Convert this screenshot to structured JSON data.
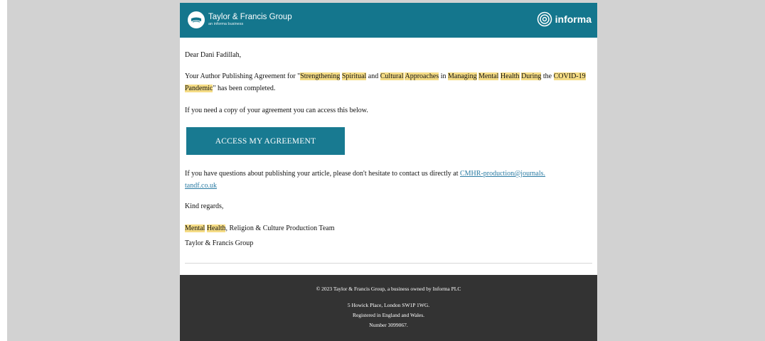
{
  "header": {
    "brand_name": "Taylor & Francis Group",
    "brand_subtitle": "an informa business",
    "partner_name": "informa",
    "background_color": "#14768d"
  },
  "email": {
    "greeting": "Dear Dani Fadillah,",
    "agreement_intro": "Your Author Publishing Agreement for \"",
    "title_parts": [
      {
        "text": "Strengthening",
        "hl": true
      },
      {
        "text": " ",
        "hl": false
      },
      {
        "text": "Spiritual",
        "hl": true
      },
      {
        "text": " and ",
        "hl": false
      },
      {
        "text": "Cultural",
        "hl": true
      },
      {
        "text": " ",
        "hl": false
      },
      {
        "text": "Approaches",
        "hl": true
      },
      {
        "text": " in ",
        "hl": false
      },
      {
        "text": "Managing",
        "hl": true
      },
      {
        "text": " ",
        "hl": false
      },
      {
        "text": "Mental",
        "hl": true
      },
      {
        "text": " ",
        "hl": false
      },
      {
        "text": "Health",
        "hl": true
      },
      {
        "text": " ",
        "hl": false
      },
      {
        "text": "During",
        "hl": true
      },
      {
        "text": " the ",
        "hl": false
      },
      {
        "text": "COVID-19",
        "hl": true
      },
      {
        "text": " ",
        "hl": false
      },
      {
        "text": "Pandemic",
        "hl": true
      }
    ],
    "agreement_outro": "\" has been completed.",
    "copy_text": "If you need a copy of your agreement you can access this below.",
    "cta_label": "ACCESS MY AGREEMENT",
    "questions_text": "If you have questions about publishing your article, please don't hesitate to contact us directly at ",
    "contact_email_line1": "CMHR-production@journals.",
    "contact_email_line2": "tandf.co.uk",
    "regards": "Kind regards,",
    "signature_hl1": "Mental",
    "signature_space": " ",
    "signature_hl2": "Health",
    "signature_rest": ", Religion & Culture Production Team",
    "signature_org": "Taylor & Francis Group"
  },
  "footer": {
    "copyright": "© 2023 Taylor & Francis Group, a business owned by Informa PLC",
    "address": "5 Howick Place, London SW1P 1WG.",
    "registered": "Registered in England and Wales.",
    "number": "Number 3099067."
  }
}
